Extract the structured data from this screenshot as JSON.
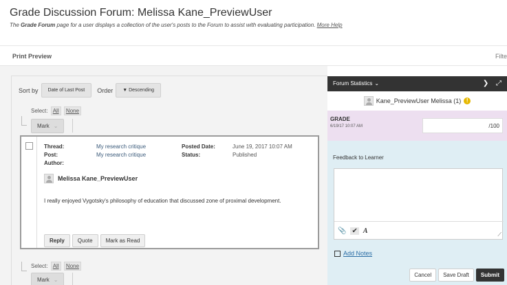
{
  "header": {
    "title": "Grade Discussion Forum: Melissa Kane_PreviewUser",
    "desc_prefix": "The ",
    "desc_bold": "Grade Forum",
    "desc_suffix": " page for a user displays a collection of the user's posts to the Forum to assist with evaluating participation. ",
    "help_link": "More Help"
  },
  "toolbar": {
    "print_preview": "Print Preview",
    "filter": "Filte"
  },
  "sort": {
    "label": "Sort by",
    "value": "Date of Last Post",
    "order_label": "Order",
    "order_value": "▼ Descending"
  },
  "select": {
    "label": "Select:",
    "all": "All",
    "none": "None"
  },
  "mark": {
    "label": "Mark",
    "chevron": "⌄"
  },
  "post": {
    "thread_label": "Thread:",
    "thread_value": "My research critique",
    "post_label": "Post:",
    "post_value": "My research critique",
    "author_label": "Author:",
    "author_name": "Melissa Kane_PreviewUser",
    "posted_label": "Posted Date:",
    "posted_value": "June 19, 2017 10:07 AM",
    "status_label": "Status:",
    "status_value": "Published",
    "body": "I really enjoyed Vygotsky's philosophy of education that discussed zone of proximal development.",
    "reply": "Reply",
    "quote": "Quote",
    "mark_read": "Mark as Read"
  },
  "stats": {
    "title": "Forum Statistics",
    "caret": "⌄",
    "next": "❯",
    "expand": "⤢",
    "user": "Kane_PreviewUser Melissa (1)",
    "warn": "!",
    "grade_label": "GRADE",
    "grade_date": "6/19/17 10:07 AM",
    "grade_value": "",
    "grade_max": "/100",
    "feedback_label": "Feedback to Learner",
    "add_notes": "Add Notes",
    "cancel": "Cancel",
    "save_draft": "Save Draft",
    "submit": "Submit"
  }
}
